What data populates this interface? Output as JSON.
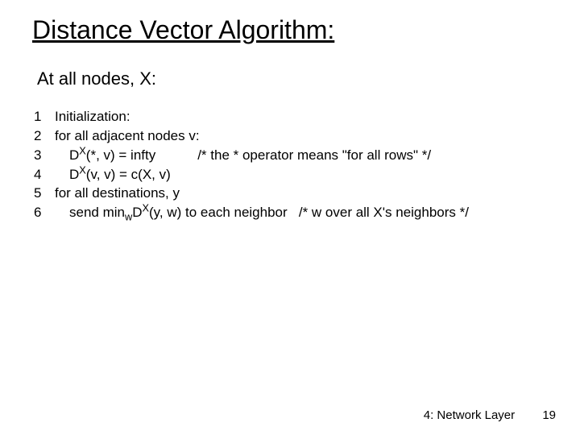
{
  "title": "Distance Vector Algorithm:",
  "subhead": "At all nodes, X:",
  "lines": {
    "l1": {
      "n": "1",
      "t1": "Initialization:"
    },
    "l2": {
      "n": "2",
      "t1": "for all adjacent nodes v:"
    },
    "l3": {
      "n": "3",
      "t1": "D",
      "sup": "X",
      "t2": "(*, v) = infty",
      "comment": "/* the * operator means \"for all rows\" */"
    },
    "l4": {
      "n": "4",
      "t1": "D",
      "sup": "X",
      "t2": "(v, v) = c(X, v)"
    },
    "l5": {
      "n": "5",
      "t1": "for all destinations, y"
    },
    "l6": {
      "n": "6",
      "t1": "send min",
      "sub": "w",
      "t2": "D",
      "sup": "X",
      "t3": "(y, w) to each neighbor",
      "comment": "/* w over all X's neighbors */"
    }
  },
  "footer": {
    "chapter": "4: Network Layer",
    "page": "19"
  }
}
